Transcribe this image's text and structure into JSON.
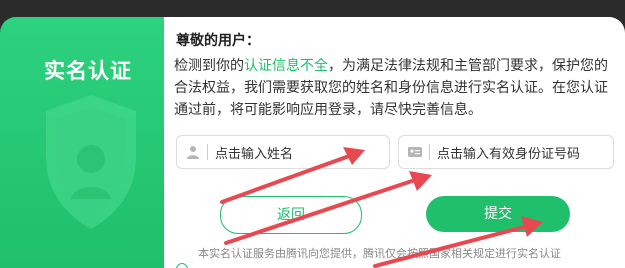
{
  "sidebar": {
    "title": "实名认证"
  },
  "dialog": {
    "greeting": "尊敬的用户：",
    "text_before": "检测到你的",
    "text_highlight": "认证信息不全",
    "text_after": "，为满足法律法规和主管部门要求，保护您的合法权益，我们需要获取您的姓名和身份信息进行实名认证。在您认证通过前，将可能影响应用登录，请尽快完善信息。"
  },
  "form": {
    "name_placeholder": "点击输入姓名",
    "id_placeholder": "点击输入有效身份证号码"
  },
  "buttons": {
    "back": "返回",
    "submit": "提交"
  },
  "footer": {
    "text": "本实名认证服务由腾讯向您提供，腾讯仅会按照国家相关规定进行实名认证"
  },
  "colors": {
    "accent": "#1fbf6b",
    "arrow": "#e8484f"
  }
}
